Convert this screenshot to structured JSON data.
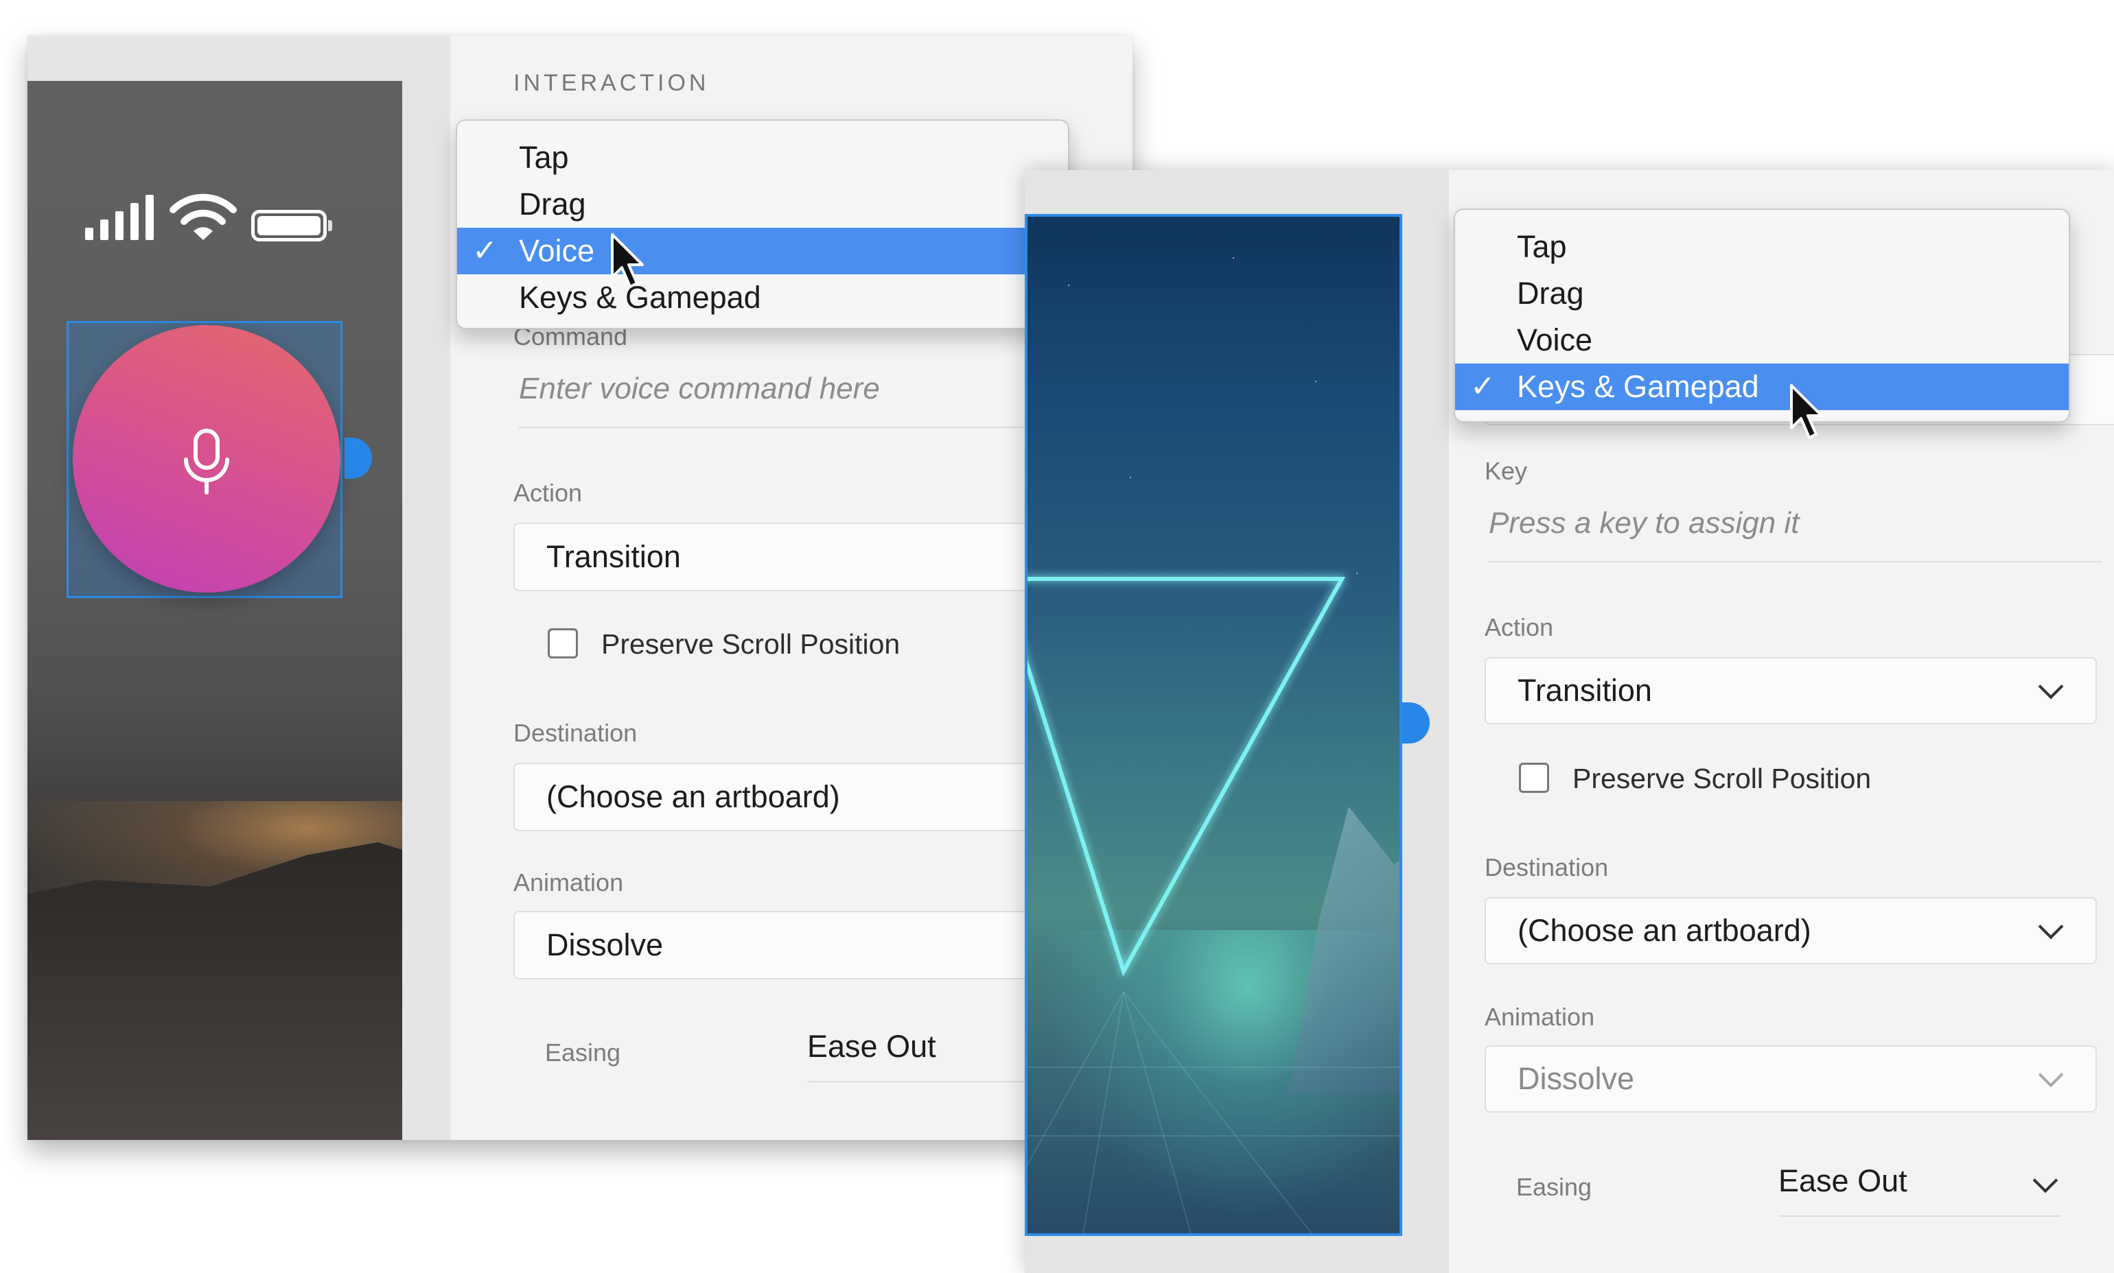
{
  "left": {
    "section_title": "INTERACTION",
    "dropdown": {
      "items": [
        {
          "label": "Tap",
          "selected": false
        },
        {
          "label": "Drag",
          "selected": false
        },
        {
          "label": "Voice",
          "selected": true
        },
        {
          "label": "Keys & Gamepad",
          "selected": false
        }
      ],
      "check": "✓"
    },
    "command_label": "Command",
    "command_placeholder": "Enter voice command here",
    "action_label": "Action",
    "action_value": "Transition",
    "preserve_label": "Preserve Scroll Position",
    "destination_label": "Destination",
    "destination_value": "(Choose an artboard)",
    "animation_label": "Animation",
    "animation_value": "Dissolve",
    "easing_label": "Easing",
    "easing_value": "Ease Out"
  },
  "right": {
    "dropdown": {
      "items": [
        {
          "label": "Tap",
          "selected": false
        },
        {
          "label": "Drag",
          "selected": false
        },
        {
          "label": "Voice",
          "selected": false
        },
        {
          "label": "Keys & Gamepad",
          "selected": true
        }
      ],
      "check": "✓"
    },
    "key_label": "Key",
    "key_placeholder": "Press a key to assign it",
    "action_label": "Action",
    "action_value": "Transition",
    "preserve_label": "Preserve Scroll Position",
    "destination_label": "Destination",
    "destination_value": "(Choose an artboard)",
    "animation_label": "Animation",
    "animation_value": "Dissolve",
    "easing_label": "Easing",
    "easing_value": "Ease Out"
  },
  "icons": {
    "signal": "cellular-signal-icon",
    "wifi": "wifi-icon",
    "battery": "battery-icon",
    "mic": "microphone-icon",
    "cursor": "mouse-pointer-icon",
    "chevron": "chevron-down-icon"
  },
  "colors": {
    "selection_blue": "#4a8ef0",
    "handle_blue": "#2687e8",
    "panel_bg": "#f3f3f3"
  }
}
